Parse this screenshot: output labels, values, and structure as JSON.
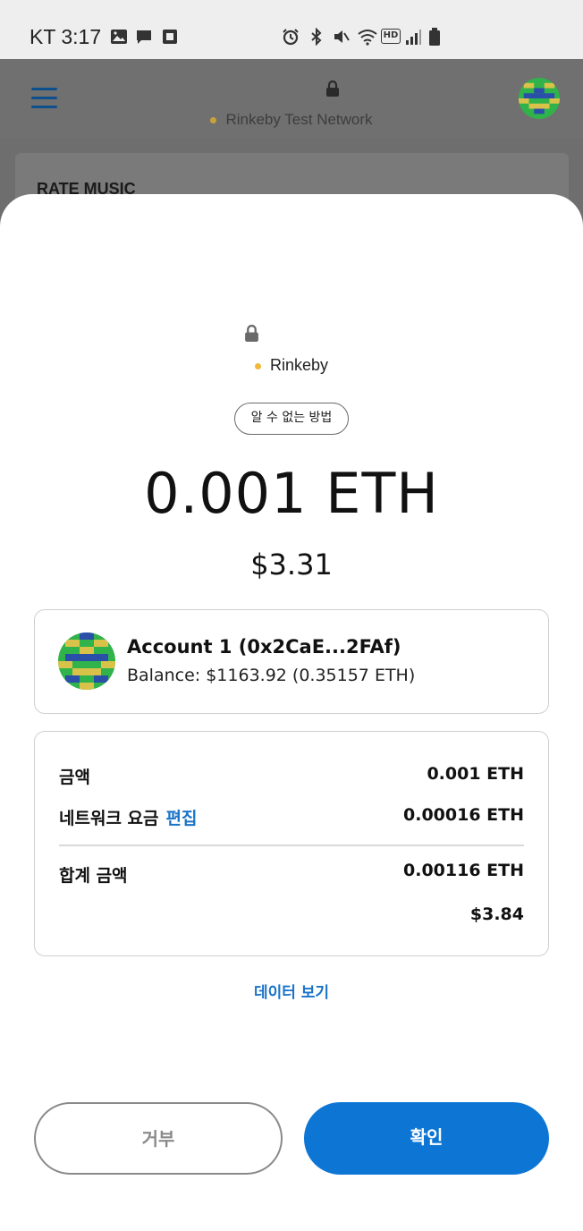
{
  "status_bar": {
    "carrier_time": "KT 3:17",
    "hd_label": "HD"
  },
  "app_header": {
    "network": "Rinkeby Test Network",
    "background_card_title": "RATE MUSIC"
  },
  "confirm": {
    "network": "Rinkeby",
    "method": "알 수 없는 방법",
    "amount": "0.001 ETH",
    "fiat": "$3.31",
    "account": {
      "name": "Account 1 (0x2CaE...2FAf)",
      "balance": "Balance: $1163.92 (0.35157 ETH)"
    },
    "fees": {
      "amount_label": "금액",
      "amount_value": "0.001 ETH",
      "network_fee_label": "네트워크 요금",
      "edit_label": "편집",
      "network_fee_value": "0.00016 ETH",
      "total_label": "합계 금액",
      "total_eth": "0.00116 ETH",
      "total_fiat": "$3.84"
    },
    "view_data": "데이터 보기",
    "reject_label": "거부",
    "confirm_label": "확인"
  },
  "colors": {
    "accent_blue": "#0d76d4",
    "network_dot": "#f0b93a",
    "avatar_green": "#2fb34a",
    "avatar_yellow": "#d9c24a",
    "avatar_blue": "#2a4fa8"
  }
}
